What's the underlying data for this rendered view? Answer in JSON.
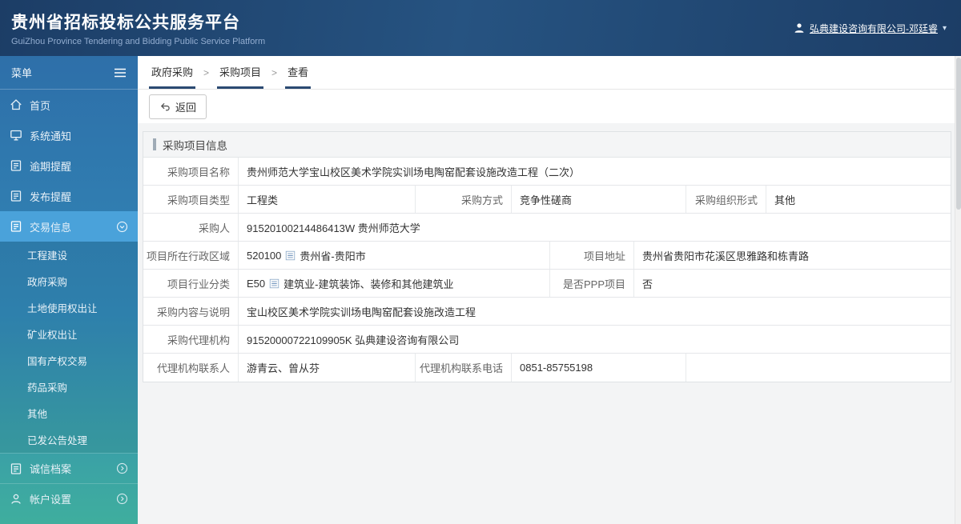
{
  "colors": {
    "header_bg": "#1c3d66",
    "sidebar_top": "#2e6fa9",
    "sidebar_bottom": "#3fae9e",
    "active_item_bg": "#4aa2da",
    "crumb_underline": "#2b4a72"
  },
  "icons": {
    "hamburger-icon": "≡",
    "user-icon": "person-silhouette",
    "caret-down-icon": "▾",
    "home-icon": "house-outline",
    "monitor-icon": "screen-outline",
    "doc-icon": "document-outline",
    "person-icon": "person-outline",
    "chevron-down-circle-icon": "circled ▾",
    "chevron-right-circle-icon": "circled ▸",
    "back-icon": "↩",
    "picker-icon": "mini-table"
  },
  "header": {
    "title": "贵州省招标投标公共服务平台",
    "subtitle": "GuiZhou Province Tendering and Bidding Public Service Platform",
    "user_label": "弘典建设咨询有限公司-邓廷睿"
  },
  "sidebar": {
    "menu_title": "菜单",
    "items": [
      {
        "label": "首页"
      },
      {
        "label": "系统通知"
      },
      {
        "label": "逾期提醒"
      },
      {
        "label": "发布提醒"
      },
      {
        "label": "交易信息",
        "active": true
      },
      {
        "label": "诚信档案"
      },
      {
        "label": "帐户设置"
      }
    ],
    "submenu": [
      {
        "label": "工程建设"
      },
      {
        "label": "政府采购"
      },
      {
        "label": "土地使用权出让"
      },
      {
        "label": "矿业权出让"
      },
      {
        "label": "国有产权交易"
      },
      {
        "label": "药品采购"
      },
      {
        "label": "其他"
      },
      {
        "label": "已发公告处理"
      }
    ]
  },
  "breadcrumb": {
    "items": [
      {
        "label": "政府采购"
      },
      {
        "label": "采购项目"
      },
      {
        "label": "查看"
      }
    ],
    "separator": ">"
  },
  "toolbar": {
    "back_label": "返回"
  },
  "panel": {
    "title": "采购项目信息",
    "rows": [
      {
        "cells": [
          {
            "label": "采购项目名称",
            "value": "贵州师范大学宝山校区美术学院实训场电陶窑配套设施改造工程（二次）"
          }
        ]
      },
      {
        "cells": [
          {
            "label": "采购项目类型",
            "value": "工程类"
          },
          {
            "label": "采购方式",
            "value": "竞争性磋商"
          },
          {
            "label": "采购组织形式",
            "value": "其他"
          }
        ]
      },
      {
        "cells": [
          {
            "label": "采购人",
            "value": "91520100214486413W 贵州师范大学"
          }
        ]
      },
      {
        "cells": [
          {
            "label": "项目所在行政区域",
            "code": "520100",
            "name": "贵州省-贵阳市"
          },
          {
            "label": "项目地址",
            "value": "贵州省贵阳市花溪区思雅路和栋青路"
          }
        ]
      },
      {
        "cells": [
          {
            "label": "项目行业分类",
            "code": "E50",
            "name": "建筑业-建筑装饰、装修和其他建筑业"
          },
          {
            "label": "是否PPP项目",
            "value": "否"
          }
        ]
      },
      {
        "cells": [
          {
            "label": "采购内容与说明",
            "value": "宝山校区美术学院实训场电陶窑配套设施改造工程"
          }
        ]
      },
      {
        "cells": [
          {
            "label": "采购代理机构",
            "value": "91520000722109905K 弘典建设咨询有限公司"
          }
        ]
      },
      {
        "cells": [
          {
            "label": "代理机构联系人",
            "value": "游青云、曾从芬"
          },
          {
            "label": "代理机构联系电话",
            "value": "0851-85755198"
          }
        ]
      }
    ]
  }
}
